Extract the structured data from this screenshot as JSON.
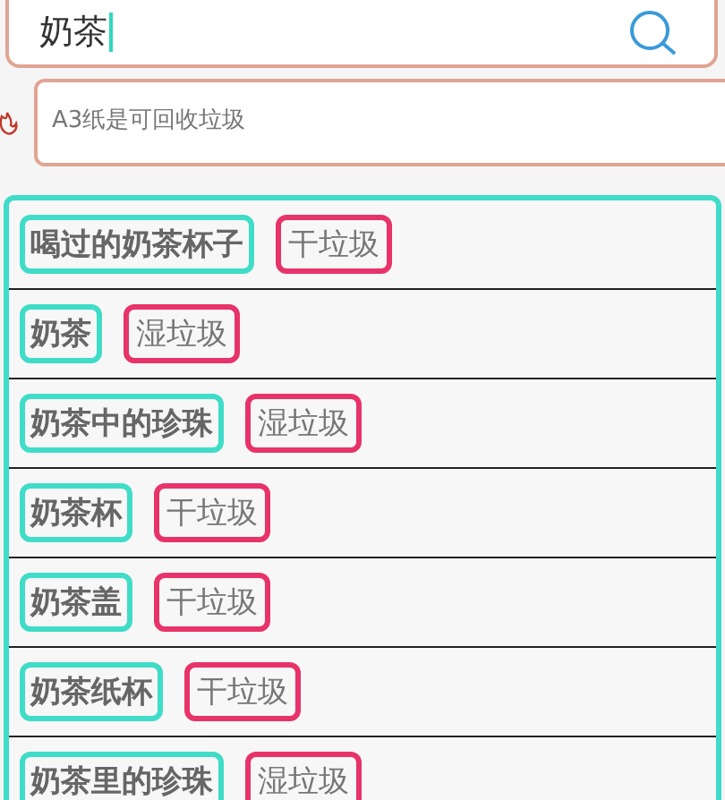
{
  "search": {
    "value": "奶茶"
  },
  "tip": {
    "text": "A3纸是可回收垃圾"
  },
  "results": [
    {
      "name": "喝过的奶茶杯子",
      "category": "干垃圾"
    },
    {
      "name": "奶茶",
      "category": "湿垃圾"
    },
    {
      "name": "奶茶中的珍珠",
      "category": "湿垃圾"
    },
    {
      "name": "奶茶杯",
      "category": "干垃圾"
    },
    {
      "name": "奶茶盖",
      "category": "干垃圾"
    },
    {
      "name": "奶茶纸杯",
      "category": "干垃圾"
    },
    {
      "name": "奶茶里的珍珠",
      "category": "湿垃圾"
    }
  ]
}
